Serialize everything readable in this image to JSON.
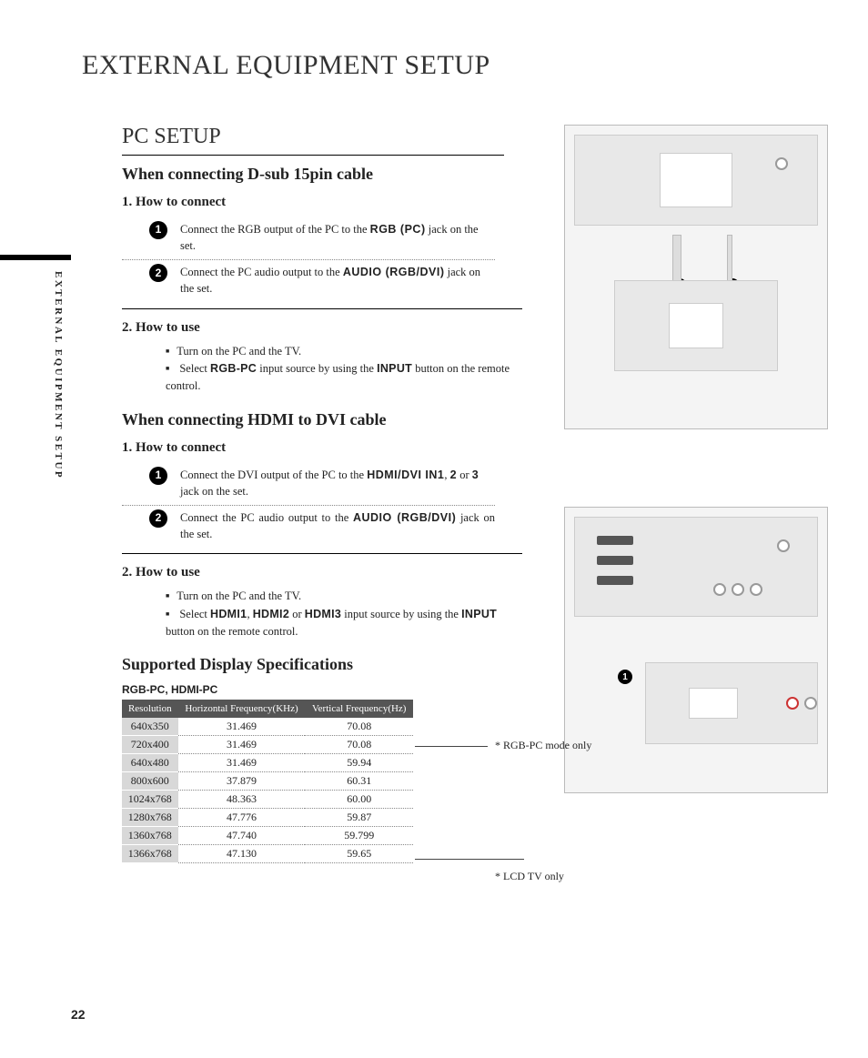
{
  "page_title": "EXTERNAL EQUIPMENT SETUP",
  "side_tab": "EXTERNAL EQUIPMENT SETUP",
  "page_number": "22",
  "section_title": "PC SETUP",
  "dsub": {
    "heading": "When connecting D-sub 15pin cable",
    "how_connect": "1. How to connect",
    "step1_a": "Connect the RGB output of the PC to the ",
    "step1_bold": "RGB (PC)",
    "step1_b": " jack on the set.",
    "step2_a": "Connect the PC audio output to the ",
    "step2_bold": "AUDIO (RGB/DVI)",
    "step2_b": " jack on the set.",
    "how_use": "2. How to use",
    "use1": "Turn on the PC and the TV.",
    "use2_a": "Select ",
    "use2_b1": "RGB-PC",
    "use2_mid": " input source by using the ",
    "use2_b2": "INPUT",
    "use2_b": " button on the remote control."
  },
  "hdmi": {
    "heading": "When connecting HDMI to DVI cable",
    "how_connect": "1. How to connect",
    "step1_a": "Connect the DVI output of the PC to the ",
    "step1_bold": "HDMI/DVI IN1",
    "step1_mid": ", ",
    "step1_b2": "2",
    "step1_or": " or ",
    "step1_b3": "3",
    "step1_b": " jack on the set.",
    "step2_a": "Connect the PC audio output to the ",
    "step2_bold": "AUDIO (RGB/DVI)",
    "step2_b": " jack on the set.",
    "how_use": "2. How to use",
    "use1": "Turn on the PC and the TV.",
    "use2_a": "Select ",
    "use2_b1": "HDMI1",
    "use2_c1": ", ",
    "use2_b2": "HDMI2",
    "use2_c2": " or ",
    "use2_b3": "HDMI3",
    "use2_mid": " input source by using the ",
    "use2_b4": "INPUT",
    "use2_b": " button on the remote control."
  },
  "spec": {
    "heading": "Supported Display Specifications",
    "subtitle": "RGB-PC, HDMI-PC",
    "cols": [
      "Resolution",
      "Horizontal Frequency(KHz)",
      "Vertical Frequency(Hz)"
    ],
    "rows": [
      {
        "res": "640x350",
        "h": "31.469",
        "v": "70.08"
      },
      {
        "res": "720x400",
        "h": "31.469",
        "v": "70.08"
      },
      {
        "res": "640x480",
        "h": "31.469",
        "v": "59.94"
      },
      {
        "res": "800x600",
        "h": "37.879",
        "v": "60.31"
      },
      {
        "res": "1024x768",
        "h": "48.363",
        "v": "60.00"
      },
      {
        "res": "1280x768",
        "h": "47.776",
        "v": "59.87"
      },
      {
        "res": "1360x768",
        "h": "47.740",
        "v": "59.799"
      },
      {
        "res": "1366x768",
        "h": "47.130",
        "v": "59.65"
      }
    ],
    "note1": "* RGB-PC mode only",
    "note2": "* LCD TV only"
  },
  "chart_data": {
    "type": "table",
    "title": "Supported Display Specifications — RGB-PC, HDMI-PC",
    "columns": [
      "Resolution",
      "Horizontal Frequency (KHz)",
      "Vertical Frequency (Hz)"
    ],
    "rows": [
      [
        "640x350",
        31.469,
        70.08
      ],
      [
        "720x400",
        31.469,
        70.08
      ],
      [
        "640x480",
        31.469,
        59.94
      ],
      [
        "800x600",
        37.879,
        60.31
      ],
      [
        "1024x768",
        48.363,
        60.0
      ],
      [
        "1280x768",
        47.776,
        59.87
      ],
      [
        "1360x768",
        47.74,
        59.799
      ],
      [
        "1366x768",
        47.13,
        59.65
      ]
    ],
    "annotations": [
      {
        "row": 1,
        "text": "* RGB-PC mode only"
      },
      {
        "row": 7,
        "text": "* LCD TV only"
      }
    ]
  }
}
